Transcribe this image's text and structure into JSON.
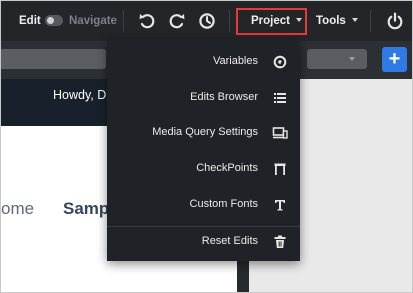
{
  "toolbar": {
    "edit_label": "Edit",
    "navigate_label": "Navigate",
    "project_label": "Project",
    "tools_label": "Tools"
  },
  "page": {
    "greeting": "Howdy, D",
    "nav_item_1": "ome",
    "nav_item_2": "Samp"
  },
  "add_button": {
    "label": "+"
  },
  "project_menu": {
    "items": [
      {
        "label": "Variables",
        "icon": "at-sign-icon"
      },
      {
        "label": "Edits Browser",
        "icon": "list-icon"
      },
      {
        "label": "Media Query Settings",
        "icon": "devices-icon"
      },
      {
        "label": "CheckPoints",
        "icon": "checkpoint-icon"
      },
      {
        "label": "Custom Fonts",
        "icon": "font-icon"
      },
      {
        "label": "Reset Edits",
        "icon": "trash-icon"
      }
    ]
  },
  "colors": {
    "toolbar_bg": "#232529",
    "menu_bg": "#1f2226",
    "highlight_border": "#e23b3b",
    "accent_blue": "#2f7ae5"
  }
}
